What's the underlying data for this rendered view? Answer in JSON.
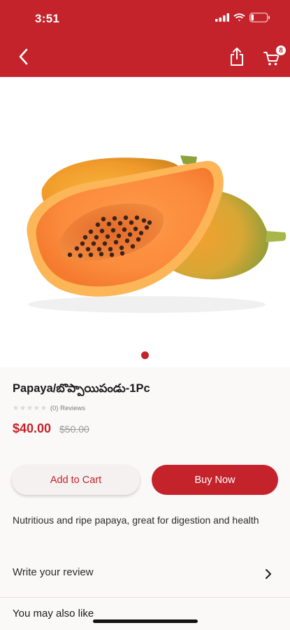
{
  "status": {
    "time": "3:51"
  },
  "header": {
    "cart_count": "8"
  },
  "product": {
    "title": "Papaya/బొప్పాయిపండు-1Pc",
    "reviews": "(0) Reviews",
    "price": "$40.00",
    "old_price": "$50.00",
    "rating": 0,
    "description": "Nutritious and ripe papaya, great for digestion and health"
  },
  "actions": {
    "add_to_cart": "Add to Cart",
    "buy_now": "Buy Now"
  },
  "review": {
    "label": "Write your review"
  },
  "related": {
    "title": "You may also like"
  },
  "carousel": {
    "count": 1,
    "active": 1
  },
  "colors": {
    "brand": "#c4232b",
    "background": "#fbf8f8"
  },
  "icons": [
    "back-arrow-icon",
    "share-icon",
    "cart-icon",
    "star-icon",
    "chevron-right-icon",
    "signal-icon",
    "wifi-icon",
    "battery-icon"
  ]
}
